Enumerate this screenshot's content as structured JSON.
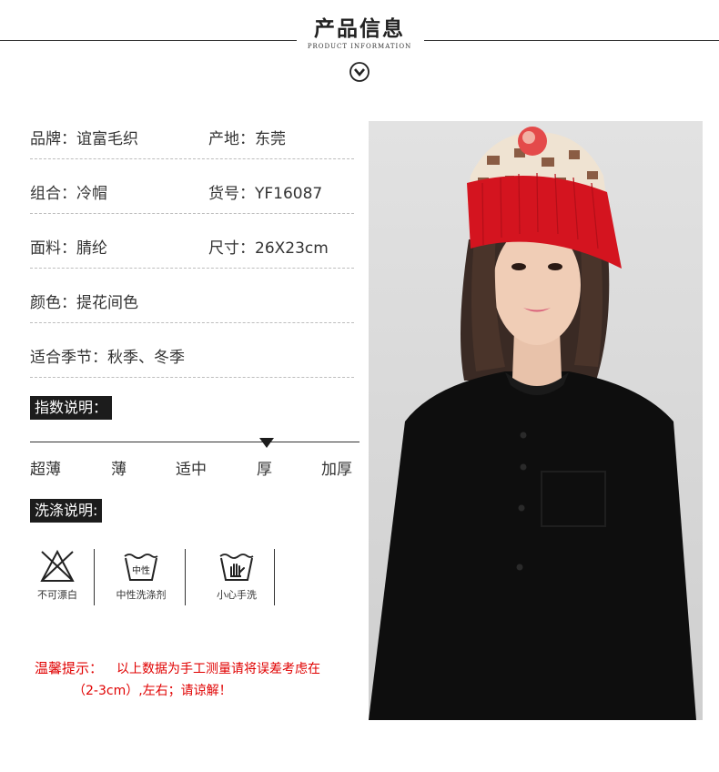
{
  "header": {
    "title": "产品信息",
    "subtitle": "PRODUCT INFORMATION",
    "arrow_icon": "chevron-down-circle-icon"
  },
  "info": {
    "brand": "品牌：谊富毛织",
    "origin": "产地：东莞",
    "group": "组合：冷帽",
    "item_no": "货号：YF16087",
    "material": "面料：腈纶",
    "size": "尺寸：26X23cm",
    "color": "颜色：提花间色",
    "season": "适合季节：秋季、冬季"
  },
  "thickness": {
    "heading": "指数说明：",
    "levels": [
      "超薄",
      "薄",
      "适中",
      "厚",
      "加厚"
    ],
    "selected_index": 3
  },
  "washing": {
    "heading": "洗涤说明:",
    "items": [
      {
        "icon": "no-bleach-icon",
        "label": "不可漂白"
      },
      {
        "icon": "neutral-detergent-icon",
        "label": "中性洗涤剂",
        "icon_text": "中性"
      },
      {
        "icon": "hand-wash-icon",
        "label": "小心手洗"
      }
    ]
  },
  "notice": {
    "prefix": "温馨提示：",
    "line1": "以上数据为手工测量请将误差考虑在",
    "line2": "（2-3cm）,左右；请谅解！"
  },
  "colors": {
    "accent_red": "#e00000",
    "tag_bg": "#1c1c1c",
    "hat_red": "#d4141f"
  }
}
